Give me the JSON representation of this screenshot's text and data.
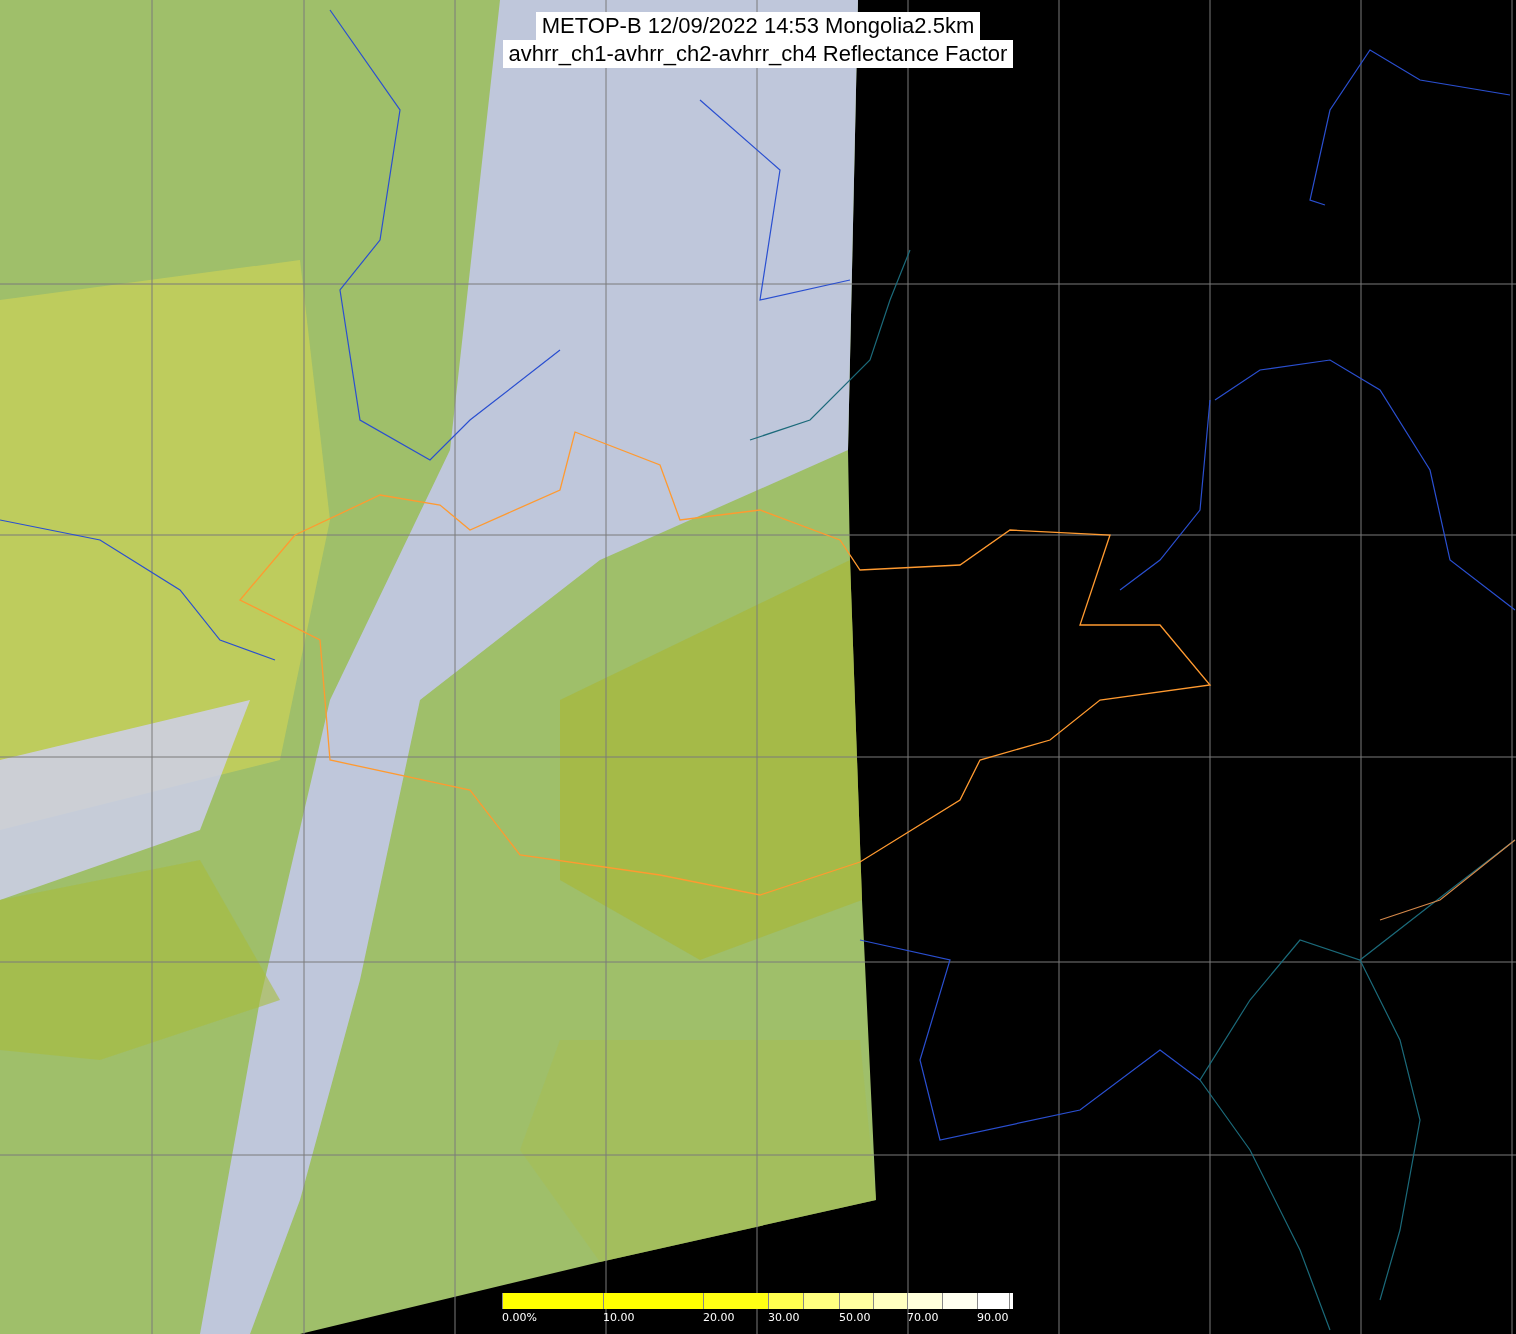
{
  "title": {
    "lines": [
      "METOP-B 12/09/2022 14:53 Mongolia2.5km",
      "avhrr_ch1-avhrr_ch2-avhrr_ch4 Reflectance Factor"
    ]
  },
  "colorbar": {
    "segments": [
      {
        "color": "#ffff00",
        "label": "0.00%"
      },
      {
        "color": "#ffff00",
        "label": "10.00"
      },
      {
        "color": "#ffff14",
        "label": "20.00"
      },
      {
        "color": "#ffff50",
        "label": "30.00"
      },
      {
        "color": "#ffff80"
      },
      {
        "color": "#ffffa0",
        "label": "50.00"
      },
      {
        "color": "#ffffc0"
      },
      {
        "color": "#ffffdc",
        "label": "70.00"
      },
      {
        "color": "#fffff0"
      },
      {
        "color": "#ffffff",
        "label": "90.00"
      },
      {
        "color": "#ffffff"
      }
    ]
  }
}
